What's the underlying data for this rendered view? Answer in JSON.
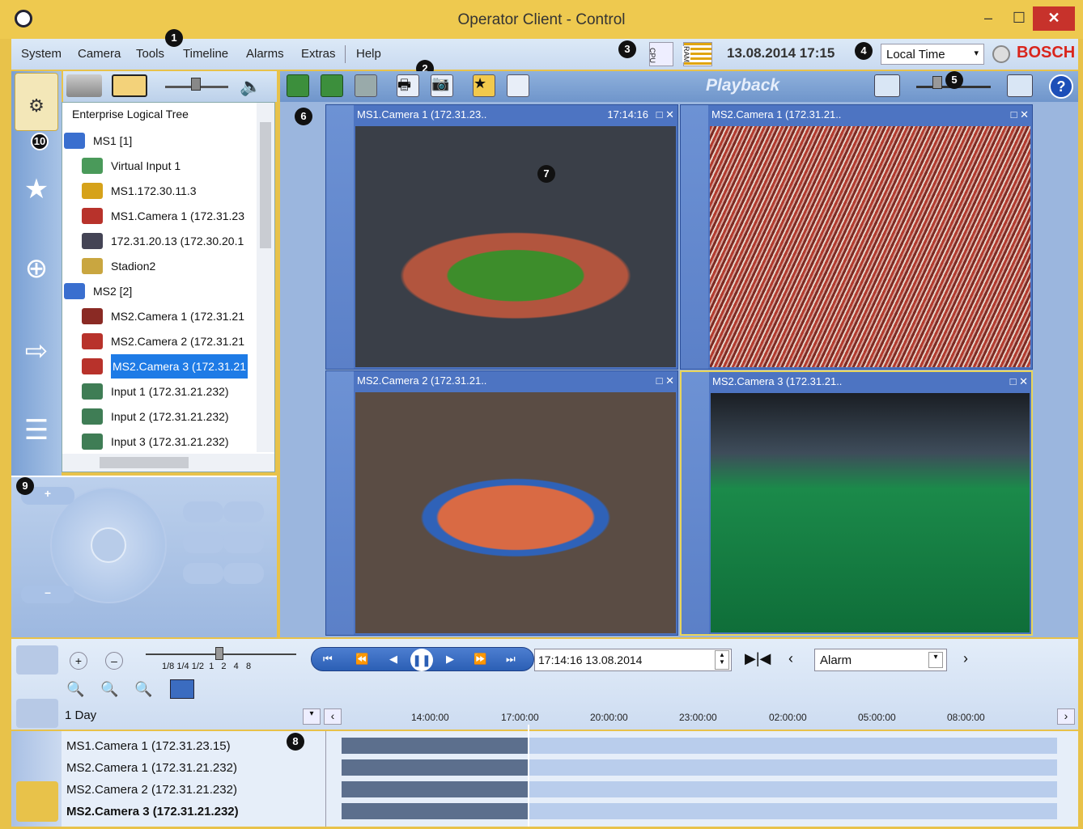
{
  "window": {
    "title": "Operator Client - Control",
    "minimize": "–",
    "maximize": "☐",
    "close": "✕"
  },
  "menu": [
    "System",
    "Camera",
    "Tools",
    "Timeline",
    "Alarms",
    "Extras",
    "Help"
  ],
  "badges": [
    "1",
    "2",
    "3",
    "4",
    "5",
    "6",
    "7",
    "8",
    "9",
    "10"
  ],
  "status": {
    "cpu": "CPU",
    "ram": "RAM",
    "datetime": "13.08.2014 17:15",
    "timezone": "Local Time",
    "brand": "BOSCH"
  },
  "toolbar": {
    "mode_label": "Playback"
  },
  "tree": {
    "root": "Enterprise Logical Tree",
    "items": [
      {
        "label": "MS1 [1]",
        "icon": "server-icon",
        "level": 0
      },
      {
        "label": "Virtual Input 1",
        "icon": "virtual-input-icon",
        "level": 1
      },
      {
        "label": "MS1.172.30.11.3",
        "icon": "database-icon",
        "level": 1
      },
      {
        "label": "MS1.Camera 1 (172.31.23",
        "icon": "camera-icon",
        "level": 1
      },
      {
        "label": "172.31.20.13 (172.30.20.1",
        "icon": "iscsi-icon",
        "level": 1
      },
      {
        "label": "Stadion2",
        "icon": "map-icon",
        "level": 1
      },
      {
        "label": "MS2 [2]",
        "icon": "server-icon",
        "level": 0
      },
      {
        "label": "MS2.Camera 1 (172.31.21",
        "icon": "dome-camera-icon",
        "level": 1
      },
      {
        "label": "MS2.Camera 2 (172.31.21",
        "icon": "camera-icon",
        "level": 1
      },
      {
        "label": "MS2.Camera 3 (172.31.21",
        "icon": "camera-icon",
        "level": 1,
        "selected": true
      },
      {
        "label": "Input 1 (172.31.21.232)",
        "icon": "input-icon",
        "level": 1
      },
      {
        "label": "Input 2 (172.31.21.232)",
        "icon": "input-icon",
        "level": 1
      },
      {
        "label": "Input 3 (172.31.21.232)",
        "icon": "input-icon",
        "level": 1
      }
    ]
  },
  "panes": [
    {
      "title": "MS1.Camera 1 (172.31.23..",
      "time": "17:14:16"
    },
    {
      "title": "MS2.Camera 1 (172.31.21..",
      "time": ""
    },
    {
      "title": "MS2.Camera 2 (172.31.21..",
      "time": ""
    },
    {
      "title": "MS2.Camera 3 (172.31.21..",
      "time": ""
    }
  ],
  "playback": {
    "speeds": "1/8 1/4 1/2  1   2   4   8",
    "datetime": "17:14:16  13.08.2014",
    "filter": "Alarm",
    "range": "1 Day",
    "ruler": [
      "14:00:00",
      "17:00:00",
      "20:00:00",
      "23:00:00",
      "02:00:00",
      "05:00:00",
      "08:00:00"
    ],
    "tracks": [
      "MS1.Camera 1 (172.31.23.15)",
      "MS2.Camera 1 (172.31.21.232)",
      "MS2.Camera 2 (172.31.21.232)",
      "MS2.Camera 3 (172.31.21.232)"
    ]
  },
  "colors": {
    "title_bar": "#eec94f",
    "selection": "#1e7be6",
    "brand": "#d9251c",
    "close": "#c7322b"
  }
}
